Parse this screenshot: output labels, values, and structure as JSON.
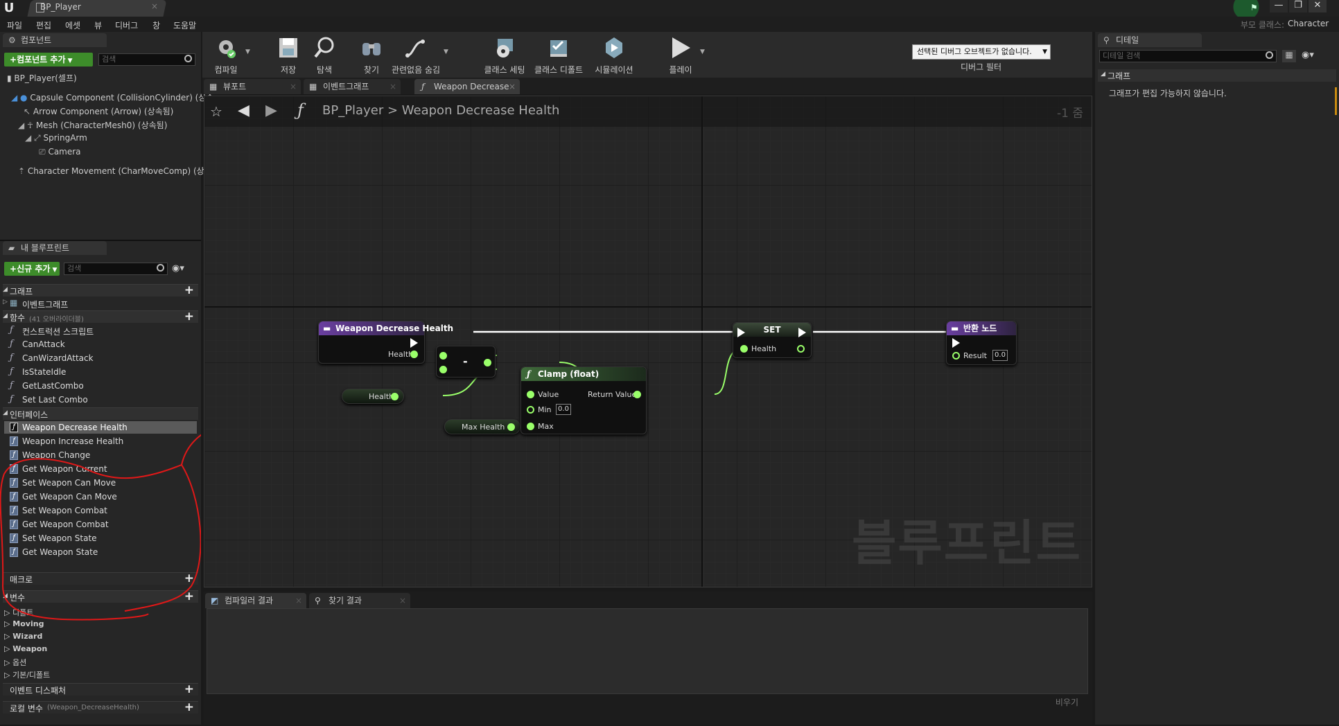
{
  "titlebar": {
    "tab_title": "BP_Player",
    "parent_class_label": "부모 클래스:",
    "parent_class_value": "Character"
  },
  "menu": [
    "파일",
    "편집",
    "에셋",
    "뷰",
    "디버그",
    "창",
    "도움말"
  ],
  "components": {
    "tab_label": "컴포넌트",
    "add_button": "컴포넌트 추가",
    "search_placeholder": "검색",
    "root": "BP_Player(셀프)",
    "items": [
      "Capsule Component (CollisionCylinder) (상속",
      "Arrow Component (Arrow) (상속됨)",
      "Mesh (CharacterMesh0) (상속됨)",
      "SpringArm",
      "Camera",
      "Character Movement (CharMoveComp) (상속"
    ]
  },
  "my_blueprint": {
    "tab_label": "내 블루프린트",
    "add_button": "신규 추가",
    "search_placeholder": "검색",
    "graph_cat": "그래프",
    "event_graph": "이벤트그래프",
    "functions_cat": "함수",
    "functions_override": "(41 오버라이더블)",
    "functions": [
      "컨스트럭션 스크립트",
      "CanAttack",
      "CanWizardAttack",
      "IsStateIdle",
      "GetLastCombo",
      "Set Last Combo"
    ],
    "interface_cat": "인터페이스",
    "interface_items": [
      "Weapon Decrease Health",
      "Weapon Increase Health",
      "Weapon Change",
      "Get Weapon Current",
      "Set Weapon Can Move",
      "Get Weapon Can Move",
      "Set Weapon Combat",
      "Get Weapon Combat",
      "Set Weapon State",
      "Get Weapon State"
    ],
    "macros_cat": "매크로",
    "vars_cat": "변수",
    "var_groups": [
      "디폴트",
      "Moving",
      "Wizard",
      "Weapon",
      "옵션",
      "기본/디폴트"
    ],
    "dispatcher_cat": "이벤트 디스패처",
    "local_vars_cat": "로컬 변수",
    "local_vars_sub": "(Weapon_DecreaseHealth)"
  },
  "toolbar": {
    "buttons": [
      "컴파일",
      "저장",
      "탐색",
      "찾기",
      "관련없음 숨김",
      "클래스 세팅",
      "클래스 디폴트",
      "시뮬레이션",
      "플레이"
    ],
    "debug_select": "선택된 디버그 오브젝트가 없습니다.",
    "debug_filter": "디버그 필터"
  },
  "graph_tabs": [
    "뷰포트",
    "이벤트그래프",
    "Weapon Decrease"
  ],
  "graph": {
    "breadcrumb_bp": "BP_Player",
    "breadcrumb_sep": ">",
    "breadcrumb_fn": "Weapon Decrease Health",
    "zoom": "-1 줌",
    "watermark": "블루프린트",
    "entry_node": {
      "title": "Weapon Decrease Health",
      "pin": "Health"
    },
    "get_health": "Health",
    "minus_node": "-",
    "clamp_node": {
      "title": "Clamp (float)",
      "value": "Value",
      "return_value": "Return Value",
      "min": "Min",
      "min_val": "0.0",
      "max": "Max"
    },
    "get_max_health": "Max Health",
    "set_node": {
      "title": "SET",
      "pin": "Health"
    },
    "return_node": {
      "title": "반환 노드",
      "pin": "Result",
      "result_val": "0.0"
    }
  },
  "details": {
    "tab_label": "디테일",
    "search_placeholder": "디테일 검색",
    "category": "그래프",
    "message": "그래프가 편집 가능하지 않습니다."
  },
  "bottom": {
    "tabs": [
      "컴파일러 결과",
      "찾기 결과"
    ],
    "clear": "비우기"
  },
  "colors": {
    "function_header": "#6a3fa0",
    "green_button": "#3d8c2a",
    "pin_float": "#9aff6a",
    "annotation_red": "#e01818"
  }
}
